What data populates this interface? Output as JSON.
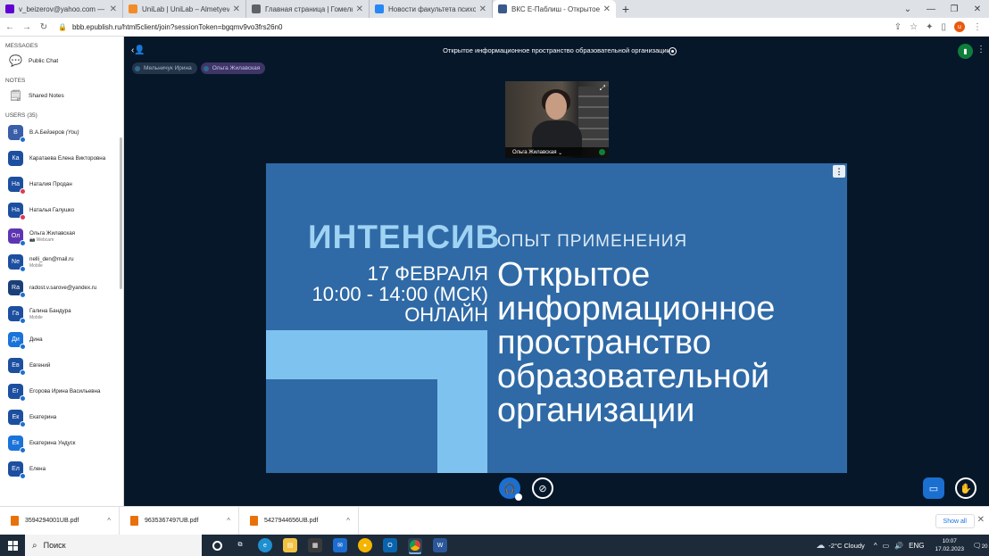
{
  "browser": {
    "tabs": [
      {
        "title": "v_beizerov@yahoo.com — Yaho",
        "color": "#6001d2",
        "active": false
      },
      {
        "title": "UniLab | UniLab – Almetyevsk St",
        "color": "#f28c28",
        "active": false
      },
      {
        "title": "Главная страница | Гомельский",
        "color": "#5f6368",
        "active": false
      },
      {
        "title": "Новости факультета психологи",
        "color": "#2787f5",
        "active": false
      },
      {
        "title": "ВКС Е-Паблиш - Открытое ...",
        "color": "#3a5a8c",
        "active": true
      }
    ],
    "new_tab": "+",
    "url": "bbb.epublish.ru/html5client/join?sessionToken=bgqmv9vo3frs26n0",
    "profile_initial": "u"
  },
  "sidebar": {
    "messages_title": "MESSAGES",
    "public_chat": "Public Chat",
    "notes_title": "NOTES",
    "shared_notes": "Shared Notes",
    "users_title": "USERS (35)",
    "users": [
      {
        "initials": "В",
        "name": "В.А.Бейзеров",
        "you": "(You)",
        "sub": "",
        "color": "#3a5ea8",
        "dot": "#1b6fd1"
      },
      {
        "initials": "Ка",
        "name": "Каратаева Елена Викторовна",
        "you": "",
        "sub": "",
        "color": "#1d4fa0",
        "dot": ""
      },
      {
        "initials": "На",
        "name": "Наталия Продан",
        "you": "",
        "sub": "",
        "color": "#1d4fa0",
        "dot": "#e0394f"
      },
      {
        "initials": "На",
        "name": "Наталья Галушко",
        "you": "",
        "sub": "",
        "color": "#1d4fa0",
        "dot": "#e0394f"
      },
      {
        "initials": "Ол",
        "name": "Ольга Жилавская",
        "you": "",
        "sub": "📷 Webcam",
        "color": "#5e35b1",
        "dot": "#1b6fd1"
      },
      {
        "initials": "Ne",
        "name": "nelli_den@mail.ru",
        "you": "",
        "sub": "Mobile",
        "color": "#1d4fa0",
        "dot": "#1b6fd1"
      },
      {
        "initials": "Ra",
        "name": "radost.v.sarove@yandex.ru",
        "you": "",
        "sub": "",
        "color": "#1a3f7a",
        "dot": "#1b6fd1"
      },
      {
        "initials": "Га",
        "name": "Галина Бандура",
        "you": "",
        "sub": "Mobile",
        "color": "#1d4fa0",
        "dot": "#1b6fd1"
      },
      {
        "initials": "Ди",
        "name": "Дина",
        "you": "",
        "sub": "",
        "color": "#1a73d9",
        "dot": "#1b6fd1"
      },
      {
        "initials": "Ев",
        "name": "Евгений",
        "you": "",
        "sub": "",
        "color": "#1d4fa0",
        "dot": "#1b6fd1"
      },
      {
        "initials": "Ег",
        "name": "Егорова Ирина Васильевна",
        "you": "",
        "sub": "",
        "color": "#1d4fa0",
        "dot": "#1b6fd1"
      },
      {
        "initials": "Ек",
        "name": "Екатерина",
        "you": "",
        "sub": "",
        "color": "#1d4fa0",
        "dot": "#1b6fd1"
      },
      {
        "initials": "Ек",
        "name": "Екатерина Ундуск",
        "you": "",
        "sub": "",
        "color": "#1a73d9",
        "dot": "#1b6fd1"
      },
      {
        "initials": "Ел",
        "name": "Елена",
        "you": "",
        "sub": "",
        "color": "#1d4fa0",
        "dot": "#1b6fd1"
      }
    ]
  },
  "meeting": {
    "title": "Открытое информационное пространство образовательной организации",
    "talkers": [
      {
        "name": "Мельничук Ирина",
        "active": false
      },
      {
        "name": "Ольга Жилавская",
        "active": true
      }
    ],
    "webcam_name": "Ольга Жилавская"
  },
  "slide": {
    "big": "ИНТЕНСИВ",
    "sub": "ОПЫТ ПРИМЕНЕНИЯ",
    "date_line1": "17 ФЕВРАЛЯ",
    "date_line2": "10:00 - 14:00 (МСК)",
    "date_line3": "ОНЛАЙН",
    "head_line1": "Открытое",
    "head_line2": "информационное",
    "head_line3": "пространство",
    "head_line4": "образовательной",
    "head_line5": "организации"
  },
  "downloads": {
    "files": [
      "3594294001UB.pdf",
      "9635367497UB.pdf",
      "5427944656UB.pdf"
    ],
    "show_all": "Show all"
  },
  "taskbar": {
    "search_placeholder": "Поиск",
    "weather": "-2°C  Cloudy",
    "lang": "ENG",
    "time": "10:07",
    "date": "17.02.2023",
    "notifications": "20"
  }
}
